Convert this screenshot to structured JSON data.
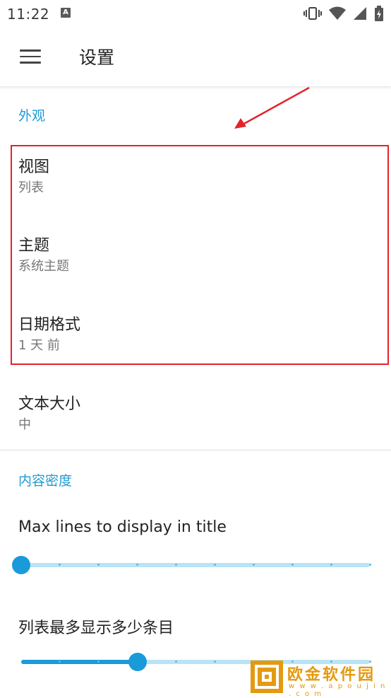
{
  "status_bar": {
    "time": "11:22",
    "badge": "A"
  },
  "app_bar": {
    "title": "设置"
  },
  "sections": [
    {
      "header": "外观"
    },
    {
      "header": "内容密度"
    }
  ],
  "appearance": {
    "view": {
      "title": "视图",
      "value": "列表"
    },
    "theme": {
      "title": "主题",
      "value": "系统主题"
    },
    "date_format": {
      "title": "日期格式",
      "value": "1 天 前"
    },
    "text_size": {
      "title": "文本大小",
      "value": "中"
    }
  },
  "content_density": {
    "max_lines_title": {
      "label": "Max lines to display in title",
      "value_fraction": 0.0,
      "steps": 10
    },
    "list_max_items": {
      "label": "列表最多显示多少条目",
      "value_fraction": 0.333,
      "steps": 10
    }
  },
  "annotation": {
    "color": "#e3232d"
  },
  "watermark": {
    "text": "欧金软件园",
    "url": "w w w . a p o u j i n . c o m",
    "color": "#e49a10"
  },
  "colors": {
    "accent": "#1e9bd6",
    "slider_track": "#b9e4f6"
  }
}
